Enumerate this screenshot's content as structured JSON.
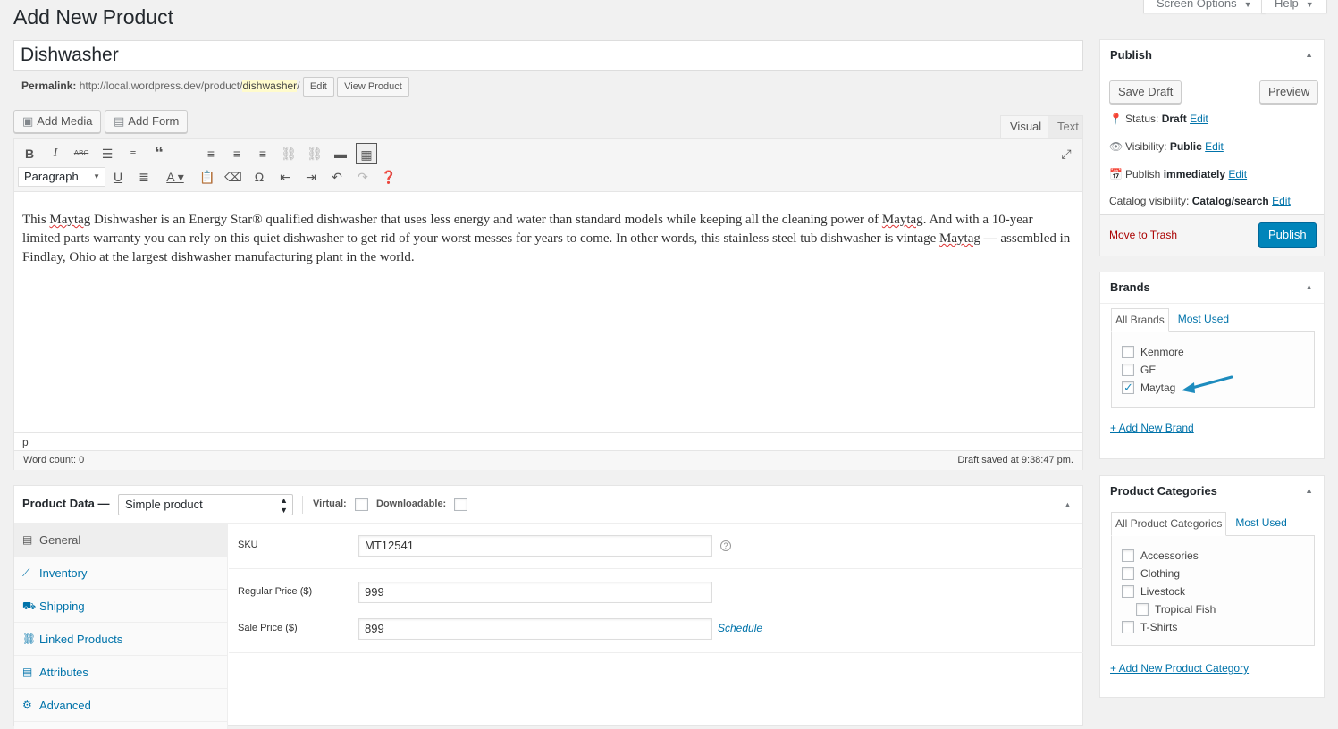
{
  "screen_tabs": {
    "screen_options": "Screen Options",
    "help": "Help"
  },
  "page": {
    "title": "Add New Product"
  },
  "post": {
    "title": "Dishwasher",
    "permalink_label": "Permalink:",
    "permalink_base": "http://local.wordpress.dev/product/",
    "permalink_slug": "dishwasher",
    "permalink_trail": "/",
    "edit_label": "Edit",
    "view_label": "View Product"
  },
  "media_buttons": {
    "add_media": "Add Media",
    "add_form": "Add Form"
  },
  "editor": {
    "tab_visual": "Visual",
    "tab_text": "Text",
    "format": "Paragraph",
    "content_parts": [
      "This ",
      "Maytag",
      " Dishwasher is an Energy Star® qualified dishwasher that uses less energy and water than standard models while keeping all the cleaning power of ",
      "Maytag",
      ". And with a 10-year limited parts warranty you can rely on this quiet dishwasher to get rid of your worst messes for years to come. In other words, this stainless steel tub dishwasher is vintage ",
      "Maytag",
      " — assembled in Findlay, Ohio at the largest dishwasher manufacturing plant in the world."
    ],
    "path": "p",
    "word_count": "Word count: 0",
    "draft_saved": "Draft saved at 9:38:47 pm."
  },
  "product_data": {
    "title": "Product Data —",
    "type": "Simple product",
    "virtual_label": "Virtual:",
    "downloadable_label": "Downloadable:",
    "tabs": [
      "General",
      "Inventory",
      "Shipping",
      "Linked Products",
      "Attributes",
      "Advanced"
    ],
    "sku_label": "SKU",
    "sku": "MT12541",
    "regular_price_label": "Regular Price ($)",
    "regular_price": "999",
    "sale_price_label": "Sale Price ($)",
    "sale_price": "899",
    "schedule": "Schedule"
  },
  "publish": {
    "title": "Publish",
    "save_draft": "Save Draft",
    "preview": "Preview",
    "status_label": "Status:",
    "status": "Draft",
    "visibility_label": "Visibility:",
    "visibility": "Public",
    "publish_label": "Publish",
    "publish_when": "immediately",
    "catalog_label": "Catalog visibility:",
    "catalog": "Catalog/search",
    "edit": "Edit",
    "trash": "Move to Trash",
    "publish_button": "Publish"
  },
  "brands": {
    "title": "Brands",
    "tab_all": "All Brands",
    "tab_most": "Most Used",
    "items": [
      {
        "label": "Kenmore",
        "checked": false
      },
      {
        "label": "GE",
        "checked": false
      },
      {
        "label": "Maytag",
        "checked": true
      }
    ],
    "add_new": "+ Add New Brand"
  },
  "categories": {
    "title": "Product Categories",
    "tab_all": "All Product Categories",
    "tab_most": "Most Used",
    "items": [
      {
        "label": "Accessories",
        "checked": false,
        "child": false
      },
      {
        "label": "Clothing",
        "checked": false,
        "child": false
      },
      {
        "label": "Livestock",
        "checked": false,
        "child": false
      },
      {
        "label": "Tropical Fish",
        "checked": false,
        "child": true
      },
      {
        "label": "T-Shirts",
        "checked": false,
        "child": false
      }
    ],
    "add_new": "+ Add New Product Category"
  },
  "colors": {
    "accent": "#0073aa",
    "primary_button": "#0085ba",
    "arrow": "#1e8cbe",
    "trash": "#aa0000"
  }
}
